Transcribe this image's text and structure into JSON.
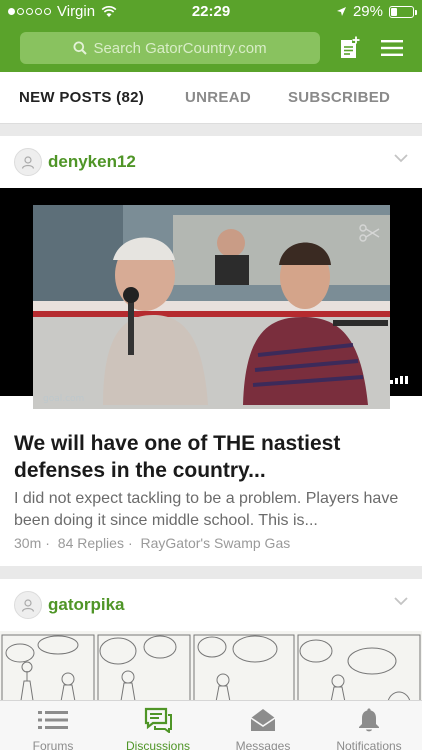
{
  "status_bar": {
    "carrier": "Virgin",
    "time": "22:29",
    "battery": "29%",
    "battery_level": 0.29
  },
  "header": {
    "search_placeholder": "Search GatorCountry.com"
  },
  "tabs": [
    {
      "label": "NEW POSTS (82)",
      "active": true
    },
    {
      "label": "UNREAD",
      "active": false
    },
    {
      "label": "SUBSCRIBED",
      "active": false
    }
  ],
  "posts": [
    {
      "author": "denyken12",
      "title": "We will have one of THE nastiest defenses in the country...",
      "excerpt": "I did not expect tackling to be a problem. Players have been doing it since middle school. This is...",
      "age": "30m",
      "replies": "84 Replies",
      "forum": "RayGator's Swamp Gas"
    },
    {
      "author": "gatorpika"
    }
  ],
  "bottom_nav": [
    {
      "label": "Forums",
      "icon": "list-icon",
      "active": false
    },
    {
      "label": "Discussions",
      "icon": "chat-bubbles-icon",
      "active": true
    },
    {
      "label": "Messages",
      "icon": "inbox-icon",
      "active": false
    },
    {
      "label": "Notifications",
      "icon": "bell-icon",
      "active": false
    }
  ],
  "colors": {
    "brand_green": "#5aa32b",
    "author_green": "#4f9527",
    "muted_text": "#8a8a8a"
  }
}
